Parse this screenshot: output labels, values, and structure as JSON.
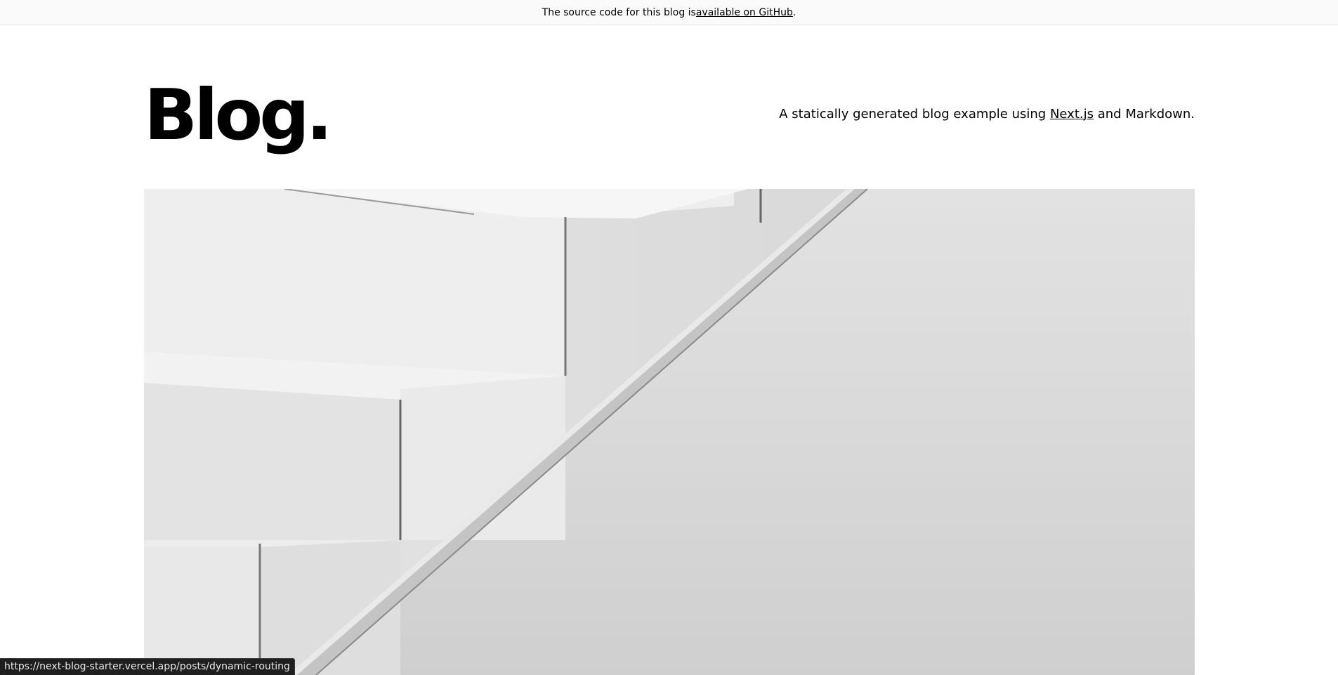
{
  "banner": {
    "text_before": "The source code for this blog is ",
    "link_text": "available on GitHub",
    "text_after": "."
  },
  "header": {
    "title": "Blog.",
    "tagline_before": "A statically generated blog example using ",
    "tagline_link": "Next.js",
    "tagline_after": " and Markdown."
  },
  "hero": {
    "image_name": "staircase-cover-image"
  },
  "status_bar": {
    "url": "https://next-blog-starter.vercel.app/posts/dynamic-routing"
  }
}
